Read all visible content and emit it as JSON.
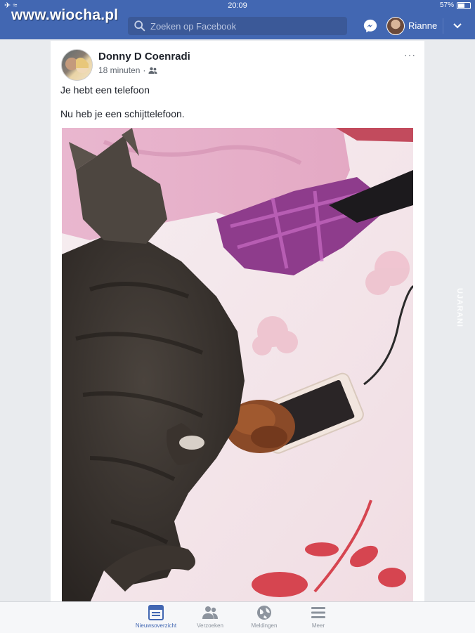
{
  "status": {
    "time": "20:09",
    "battery": "57%",
    "battery_level": 0.57
  },
  "watermark": {
    "site": "www.wiocha.pl",
    "side": "UJARANI"
  },
  "header": {
    "search_placeholder": "Zoeken op Facebook",
    "user_name": "Rianne"
  },
  "post": {
    "author": "Donny D Coenradi",
    "time": "18 minuten",
    "privacy_icon": "friends-icon",
    "more_label": "···",
    "text_line1": "Je hebt een telefoon",
    "text_line2": "Nu heb je een schijttelefoon."
  },
  "tabs": [
    {
      "label": "Nieuwsoverzicht",
      "icon": "news-feed-icon",
      "active": true
    },
    {
      "label": "Verzoeken",
      "icon": "friend-requests-icon",
      "active": false
    },
    {
      "label": "Meldingen",
      "icon": "globe-icon",
      "active": false
    },
    {
      "label": "Meer",
      "icon": "menu-icon",
      "active": false
    }
  ],
  "colors": {
    "brand": "#4267b2",
    "background": "#e9ebee",
    "text": "#1d2129",
    "muted": "#606770"
  }
}
